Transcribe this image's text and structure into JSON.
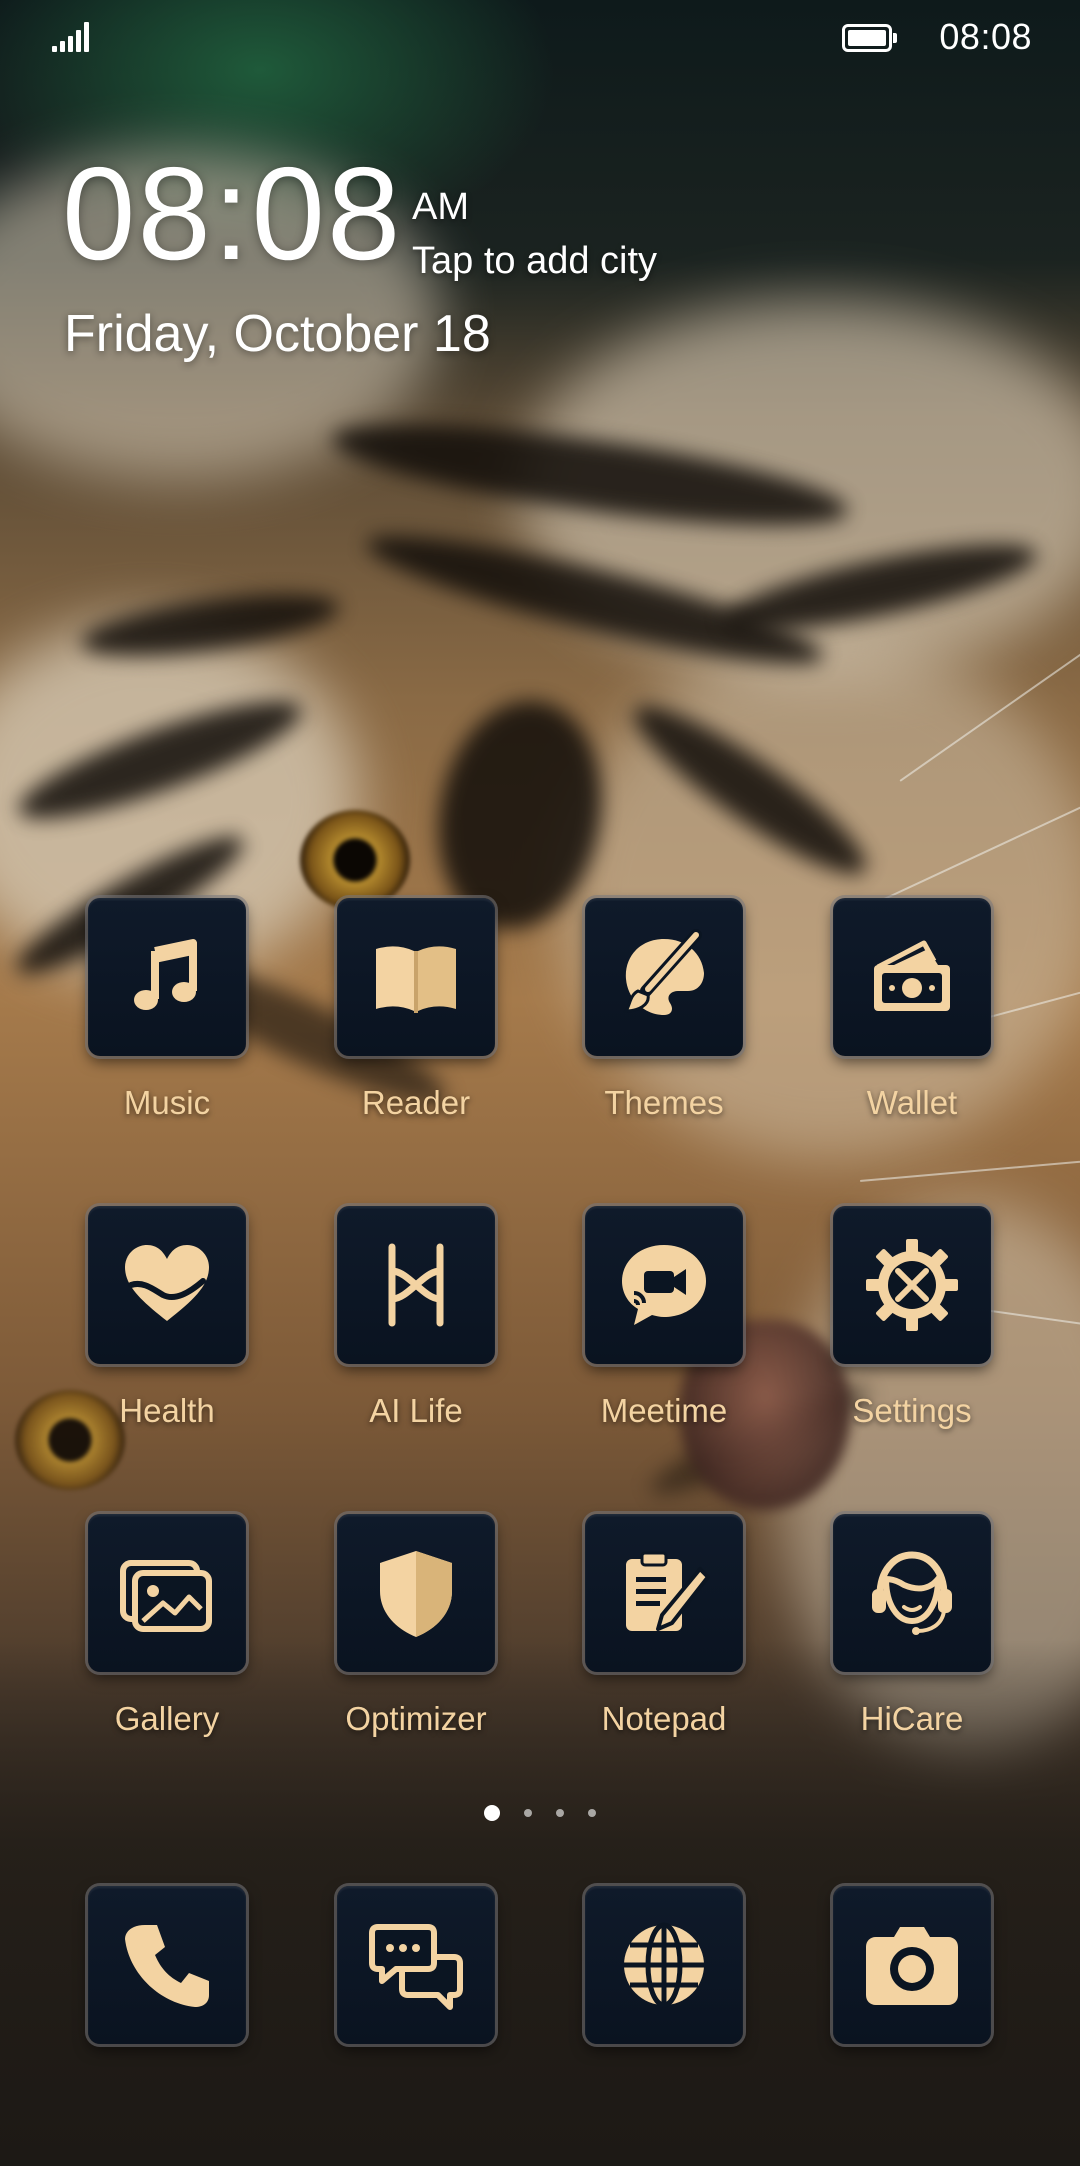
{
  "status_bar": {
    "time": "08:08",
    "signal_icon": "signal-bars-icon",
    "battery_icon": "battery-full-icon"
  },
  "clock_widget": {
    "time": "08:08",
    "ampm": "AM",
    "city_prompt": "Tap to add city",
    "date": "Friday, October 18"
  },
  "theme": {
    "icon_color": "#f3d3a2",
    "tile_color": "#0d1727",
    "label_color": "#f3d3a2"
  },
  "apps": [
    {
      "label": "Music",
      "icon": "music-note-icon"
    },
    {
      "label": "Reader",
      "icon": "open-book-icon"
    },
    {
      "label": "Themes",
      "icon": "paintbrush-palette-icon"
    },
    {
      "label": "Wallet",
      "icon": "wallet-cash-icon"
    },
    {
      "label": "Health",
      "icon": "heart-icon"
    },
    {
      "label": "AI Life",
      "icon": "ai-life-logo-icon"
    },
    {
      "label": "Meetime",
      "icon": "video-chat-bubble-icon"
    },
    {
      "label": "Settings",
      "icon": "gear-tools-icon"
    },
    {
      "label": "Gallery",
      "icon": "photo-gallery-icon"
    },
    {
      "label": "Optimizer",
      "icon": "shield-icon"
    },
    {
      "label": "Notepad",
      "icon": "clipboard-pencil-icon"
    },
    {
      "label": "HiCare",
      "icon": "headset-support-icon"
    }
  ],
  "page_indicator": {
    "pages": 4,
    "current": 1
  },
  "dock": [
    {
      "icon": "phone-icon"
    },
    {
      "icon": "chat-bubbles-icon"
    },
    {
      "icon": "globe-icon"
    },
    {
      "icon": "camera-icon"
    }
  ]
}
